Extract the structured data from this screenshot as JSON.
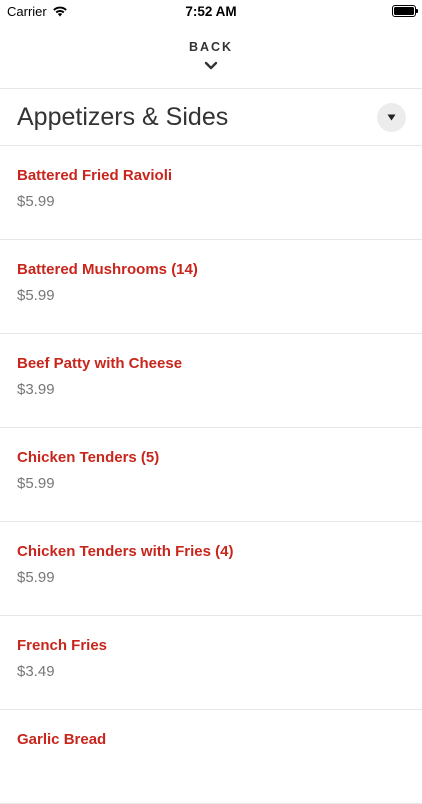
{
  "status_bar": {
    "carrier": "Carrier",
    "time": "7:52 AM",
    "icons": [
      "wifi-icon",
      "battery-icon"
    ]
  },
  "nav": {
    "back_label": "BACK",
    "back_icon": "chevron-down-icon"
  },
  "category": {
    "title": "Appetizers & Sides",
    "dropdown_icon": "triangle-down-icon"
  },
  "colors": {
    "item_name": "#c8261d",
    "price": "#777777",
    "divider": "#e6e6e6"
  },
  "items": [
    {
      "name": "Battered Fried Ravioli",
      "price": "$5.99"
    },
    {
      "name": "Battered Mushrooms (14)",
      "price": "$5.99"
    },
    {
      "name": "Beef Patty with Cheese",
      "price": "$3.99"
    },
    {
      "name": "Chicken Tenders (5)",
      "price": "$5.99"
    },
    {
      "name": "Chicken Tenders with Fries (4)",
      "price": "$5.99"
    },
    {
      "name": "French Fries",
      "price": "$3.49"
    },
    {
      "name": "Garlic Bread",
      "price": ""
    }
  ]
}
